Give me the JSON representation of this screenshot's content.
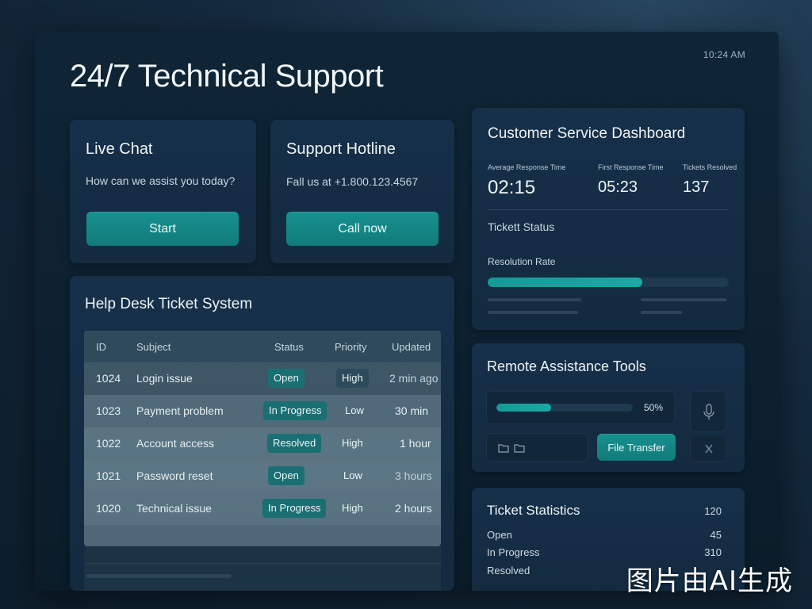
{
  "header": {
    "time": "10:24 AM",
    "title": "24/7 Technical Support"
  },
  "live_chat": {
    "title": "Live Chat",
    "text": "How can we assist you today?",
    "button": "Start"
  },
  "hotline": {
    "title": "Support Hotline",
    "text": "Fall us at +1.800.123.4567",
    "button": "Call now"
  },
  "tickets": {
    "title": "Help Desk Ticket System",
    "columns": [
      "ID",
      "Subject",
      "Status",
      "Priority",
      "Updated"
    ],
    "rows": [
      {
        "id": "1024",
        "subject": "Login issue",
        "status": "Open",
        "priority": "High",
        "updated": "2 min ago"
      },
      {
        "id": "1023",
        "subject": "Payment problem",
        "status": "In Progress",
        "priority": "Low",
        "updated": "30 min"
      },
      {
        "id": "1022",
        "subject": "Account access",
        "status": "Resolved",
        "priority": "High",
        "updated": "1 hour"
      },
      {
        "id": "1021",
        "subject": "Password reset",
        "status": "Open",
        "priority": "Low",
        "updated": "3 hours"
      },
      {
        "id": "1020",
        "subject": "Technical issue",
        "status": "In Progress",
        "priority": "High",
        "updated": "2 hours"
      }
    ]
  },
  "dashboard": {
    "title": "Customer Service Dashboard",
    "metrics": [
      {
        "label": "Average Response Time",
        "value": "02:15"
      },
      {
        "label": "First Response Time",
        "value": "05:23"
      },
      {
        "label": "Tickets Resolved",
        "value": "137"
      }
    ],
    "ticket_status_label": "Tickett Status",
    "resolution_label": "Resolution Rate",
    "resolution_rate": 0.64
  },
  "remote": {
    "title": "Remote Assistance Tools",
    "progress_label": "50%",
    "progress": 0.4,
    "file_transfer_button": "File Transfer"
  },
  "stats": {
    "title": "Ticket Statistics",
    "total": "120",
    "items": [
      {
        "label": "Open",
        "value": "45"
      },
      {
        "label": "In Progress",
        "value": "310"
      },
      {
        "label": "Resolved",
        "value": ""
      }
    ]
  },
  "watermark": "图片由AI生成",
  "colors": {
    "accent": "#17918f",
    "badge": "#1a6f73",
    "panel": "#16304a",
    "background": "#0d2030"
  }
}
